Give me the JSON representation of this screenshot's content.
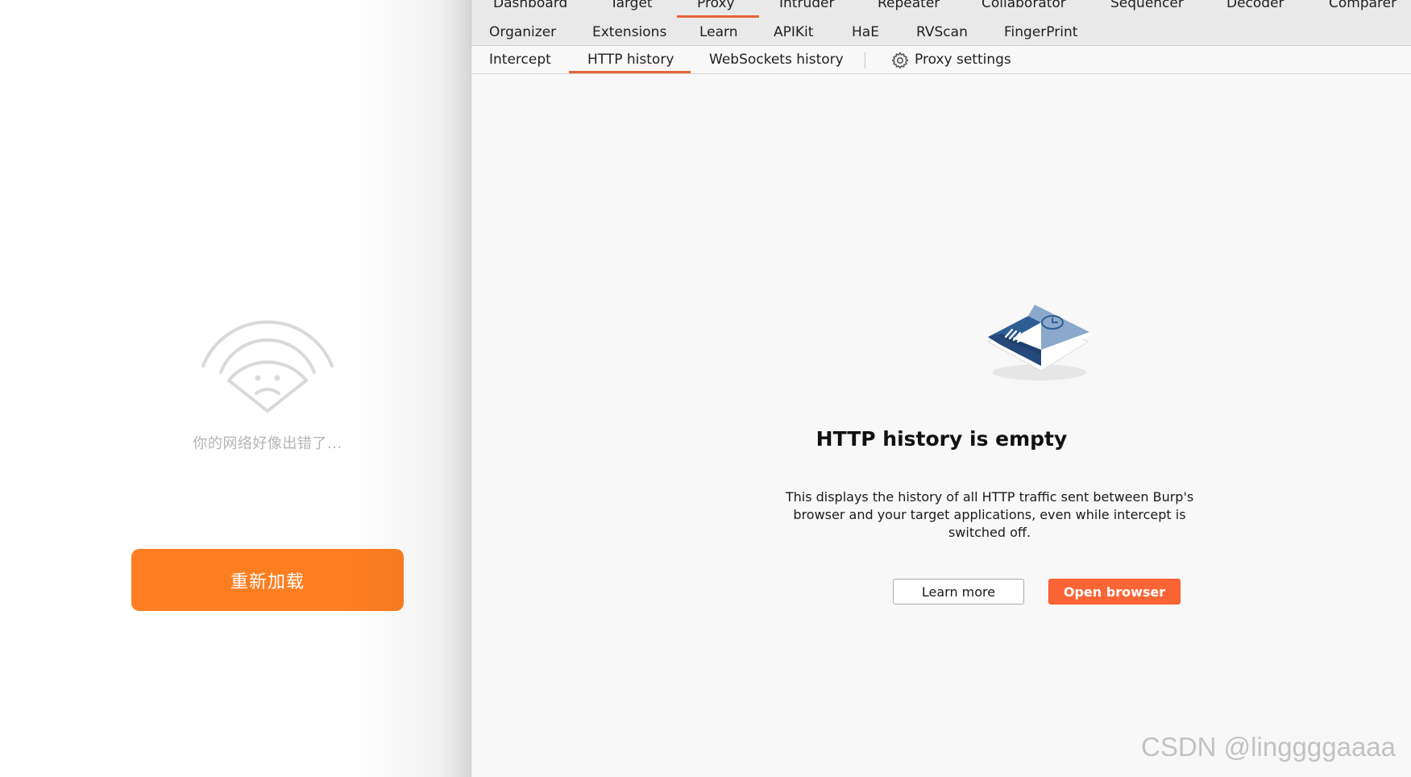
{
  "left": {
    "error_message": "你的网络好像出错了...",
    "reload_label": "重新加载",
    "icon": "wifi-sad-icon",
    "accent": "#fd7e20"
  },
  "burp": {
    "main_tabs_row1": [
      "Dashboard",
      "Target",
      "Proxy",
      "Intruder",
      "Repeater",
      "Collaborator",
      "Sequencer",
      "Decoder",
      "Comparer"
    ],
    "main_tabs_row2": [
      "Organizer",
      "Extensions",
      "Learn",
      "APIKit",
      "HaE",
      "RVScan",
      "FingerPrint"
    ],
    "active_main_tab": "Proxy",
    "sub_tabs": [
      "Intercept",
      "HTTP history",
      "WebSockets history"
    ],
    "active_sub_tab": "HTTP history",
    "proxy_settings_label": "Proxy settings",
    "empty_state": {
      "title": "HTTP history is empty",
      "description": "This displays the history of all HTTP traffic sent between Burp's browser and your target applications, even while intercept is switched off.",
      "learn_more_label": "Learn more",
      "open_browser_label": "Open browser"
    },
    "accent": "#e8623a",
    "button_color": "#fb6536"
  },
  "watermark": "CSDN @linggggaaaa"
}
